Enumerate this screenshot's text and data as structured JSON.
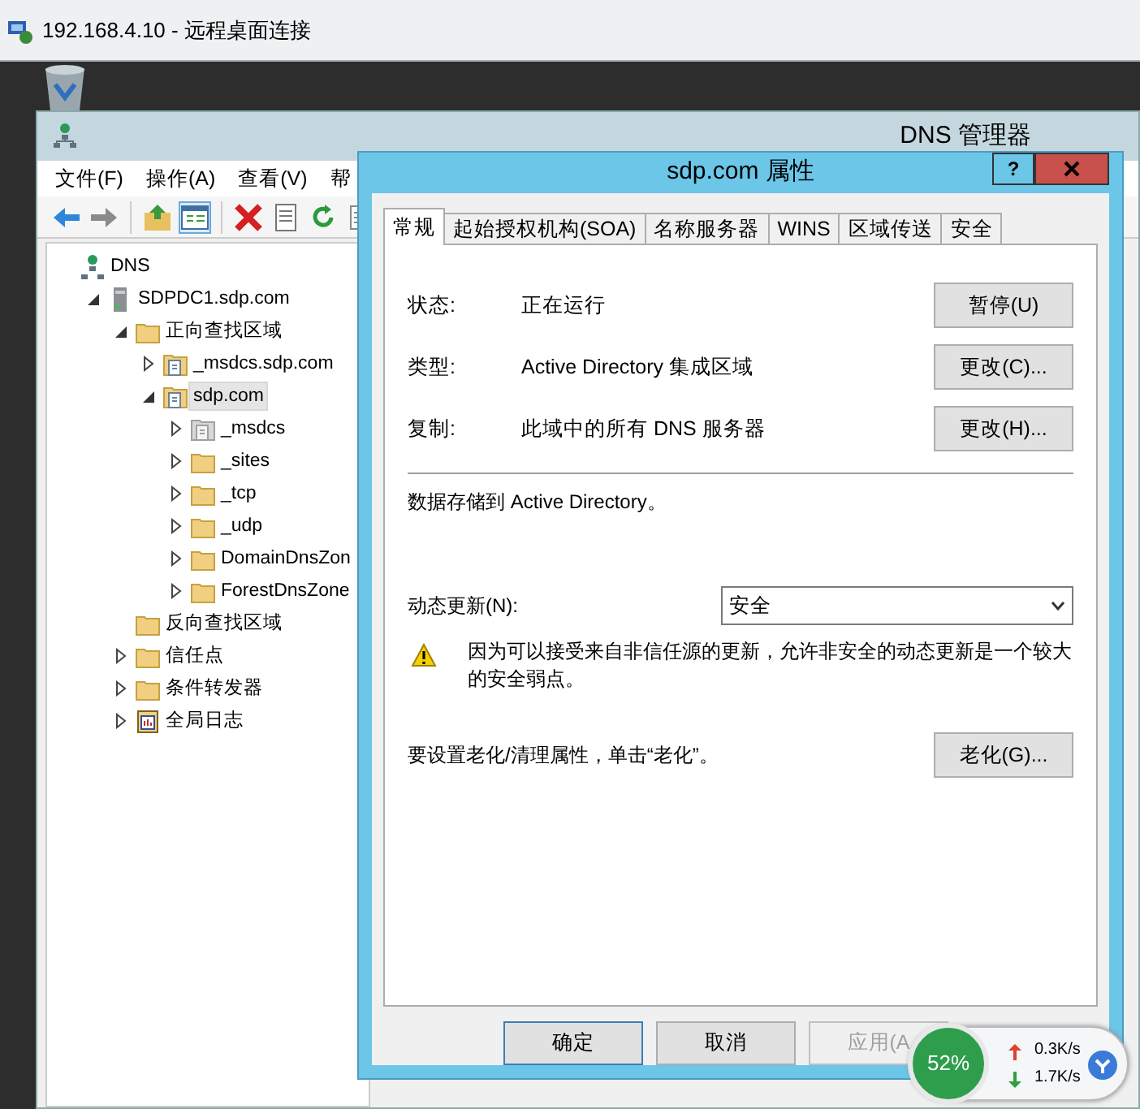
{
  "remote_window": {
    "title": "192.168.4.10 - 远程桌面连接"
  },
  "dns_manager": {
    "title": "DNS 管理器",
    "menu": [
      "文件(F)",
      "操作(A)",
      "查看(V)",
      "帮"
    ],
    "tree": [
      {
        "label": "DNS",
        "kind": "dns",
        "selected": false,
        "children": [
          {
            "label": "SDPDC1.sdp.com",
            "kind": "server",
            "expanded": true,
            "selected": false,
            "children": [
              {
                "label": "正向查找区域",
                "kind": "folder",
                "expanded": true,
                "selected": false,
                "children": [
                  {
                    "label": "_msdcs.sdp.com",
                    "kind": "zone",
                    "expanded": false,
                    "selected": false
                  },
                  {
                    "label": "sdp.com",
                    "kind": "zone",
                    "expanded": true,
                    "selected": true,
                    "children": [
                      {
                        "label": "_msdcs",
                        "kind": "zone-grey",
                        "expanded": false,
                        "selected": false
                      },
                      {
                        "label": "_sites",
                        "kind": "folder",
                        "expanded": false,
                        "selected": false
                      },
                      {
                        "label": "_tcp",
                        "kind": "folder",
                        "expanded": false,
                        "selected": false
                      },
                      {
                        "label": "_udp",
                        "kind": "folder",
                        "expanded": false,
                        "selected": false
                      },
                      {
                        "label": "DomainDnsZon",
                        "kind": "folder",
                        "expanded": false,
                        "selected": false
                      },
                      {
                        "label": "ForestDnsZone",
                        "kind": "folder",
                        "expanded": false,
                        "selected": false
                      }
                    ]
                  }
                ]
              },
              {
                "label": "反向查找区域",
                "kind": "folder",
                "selected": false
              },
              {
                "label": "信任点",
                "kind": "folder",
                "expanded": false,
                "selected": false
              },
              {
                "label": "条件转发器",
                "kind": "folder",
                "expanded": false,
                "selected": false
              },
              {
                "label": "全局日志",
                "kind": "log",
                "expanded": false,
                "selected": false
              }
            ]
          }
        ]
      }
    ]
  },
  "dialog": {
    "title": "sdp.com 属性",
    "help": "?",
    "tabs": [
      {
        "label": "常规",
        "selected": true
      },
      {
        "label": "起始授权机构(SOA)",
        "selected": false
      },
      {
        "label": "名称服务器",
        "selected": false
      },
      {
        "label": "WINS",
        "selected": false
      },
      {
        "label": "区域传送",
        "selected": false
      },
      {
        "label": "安全",
        "selected": false
      }
    ],
    "rows": [
      {
        "label": "状态:",
        "value": "正在运行",
        "button": "暂停(U)"
      },
      {
        "label": "类型:",
        "value": "Active Directory 集成区域",
        "button": "更改(C)..."
      },
      {
        "label": "复制:",
        "value": "此域中的所有 DNS 服务器",
        "button": "更改(H)..."
      }
    ],
    "storage_note": "数据存储到 Active Directory。",
    "dynamic_update": {
      "label": "动态更新(N):",
      "value": "安全"
    },
    "warning": "因为可以接受来自非信任源的更新，允许非安全的动态更新是一个较大的安全弱点。",
    "aging": {
      "text": "要设置老化/清理属性，单击“老化”。",
      "button": "老化(G)..."
    },
    "buttons": [
      {
        "label": "确定",
        "default": true,
        "disabled": false
      },
      {
        "label": "取消",
        "default": false,
        "disabled": false
      },
      {
        "label": "应用(A",
        "default": false,
        "disabled": true
      }
    ]
  },
  "network_widget": {
    "percent": "52%",
    "upload": "0.3K/s",
    "download": "1.7K/s"
  }
}
